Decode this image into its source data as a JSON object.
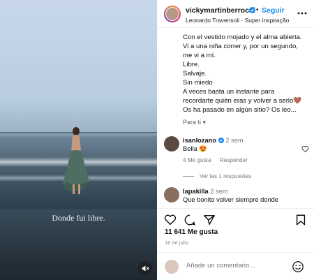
{
  "post_media": {
    "overlay_caption": "Donde fui libre."
  },
  "header": {
    "username": "vickymartinberrocal",
    "follow_label": "Seguir",
    "separator": "•",
    "subline": "Leonardo Travensoli · Super inspiração"
  },
  "caption": {
    "lines": [
      "Con el vestido mojado y el alma abierta.",
      "Vi a una niña correr y, por un segundo,",
      "me vi a mí.",
      "Libre.",
      "Salvaje.",
      "Sin miedo",
      "A veces basta un instante para",
      "recordarte quién eras y volver a serlo🤎",
      "Os ha pasado en algún sitio? Os leo..."
    ],
    "translate_label": "Para ti ▾"
  },
  "comments": [
    {
      "user": "isanlozano",
      "time": "2 sem",
      "text": "Bella 😍",
      "likes": "4 Me gusta",
      "reply": "Responder"
    },
    {
      "user": "lapakilla",
      "time": "2 sem",
      "text": "Que bonito volver siempre donde"
    }
  ],
  "view_replies": "Ver las 1 respuestas",
  "likes_count": "11 641 Me gusta",
  "post_date": "16 de julio",
  "add_comment_placeholder": "Añade un comentario..."
}
